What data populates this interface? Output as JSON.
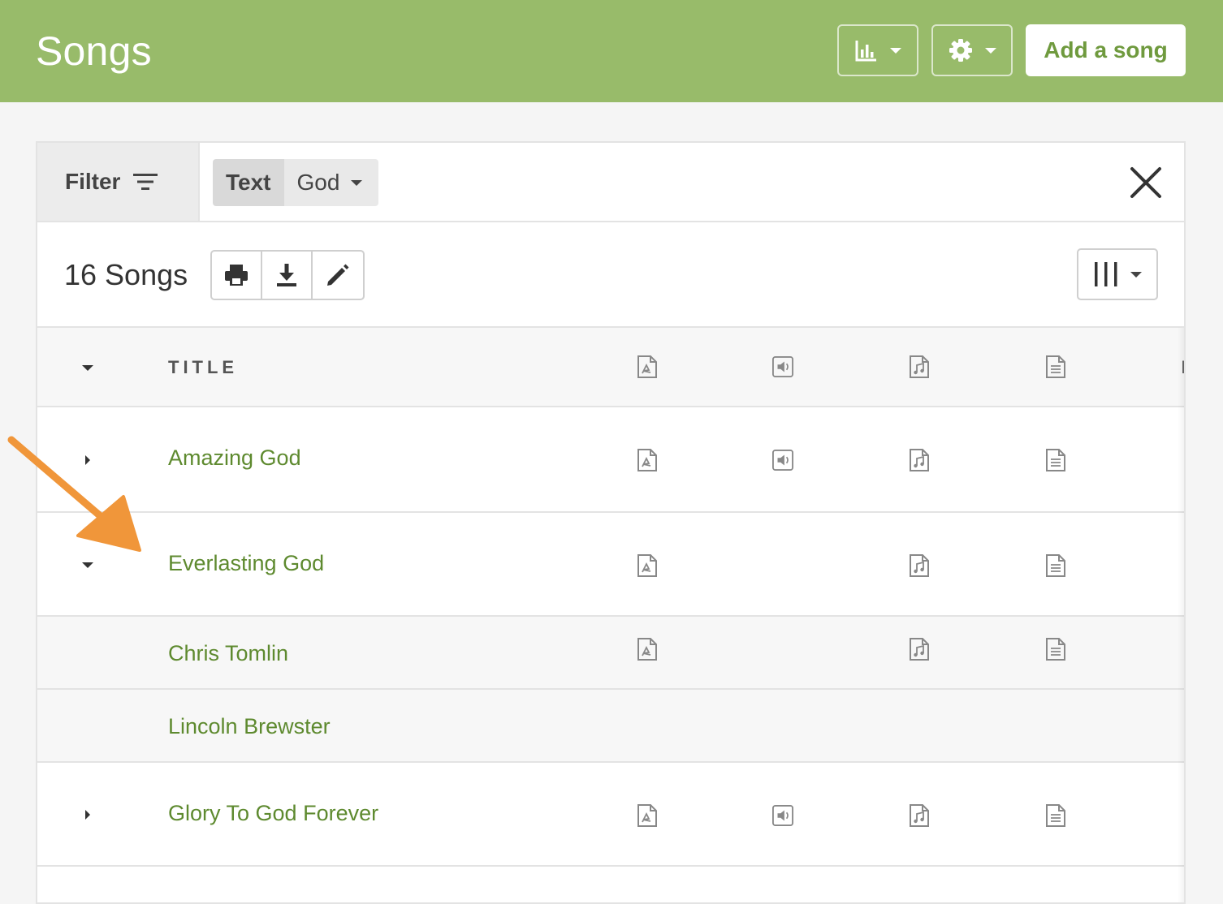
{
  "header": {
    "title": "Songs",
    "reports_icon": "bar-chart-icon",
    "settings_icon": "gear-icon",
    "add_song_label": "Add a song",
    "bg_color": "#98bb6a"
  },
  "filter": {
    "label": "Filter",
    "chip_key": "Text",
    "chip_value": "God"
  },
  "toolbar": {
    "count_label": "16 Songs"
  },
  "table": {
    "header_title": "TITLE",
    "rows": [
      {
        "title": "Amazing God",
        "expander": "collapsed"
      },
      {
        "title": "Everlasting God",
        "expander": "expanded"
      },
      {
        "title": "Chris Tomlin",
        "expander": "none"
      },
      {
        "title": "Lincoln Brewster",
        "expander": "none"
      },
      {
        "title": "Glory To God Forever",
        "expander": "collapsed"
      }
    ]
  },
  "accent_color": "#5e8a2f",
  "annotation_color": "#f0963a"
}
